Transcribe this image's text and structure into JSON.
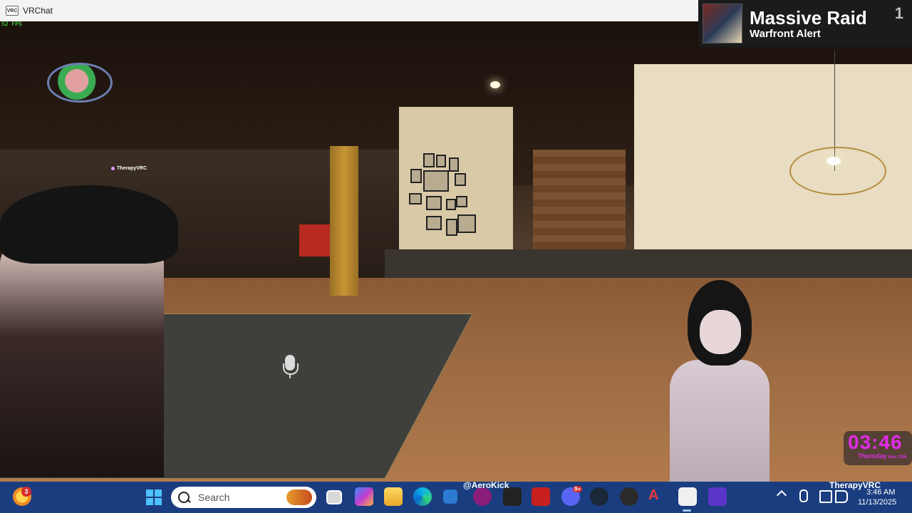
{
  "window": {
    "title": "VRChat",
    "app_icon_text": "VRC"
  },
  "viewport": {
    "fps_text": "52 FPS",
    "nametag": "TherapyVRC"
  },
  "notification": {
    "title": "Massive Raid",
    "subtitle": "Warfront Alert",
    "count": "1"
  },
  "clock_widget": {
    "time": "03:46",
    "day": "Thursday",
    "date_small": "Nov 13th",
    "color": "#e02ce6"
  },
  "taskbar": {
    "weather_badge": "3",
    "search_placeholder": "Search",
    "kick_label": "@AeroKick",
    "user_label": "TherapyVRC",
    "time": "3:46 AM",
    "date": "11/13/2025",
    "discord_badge": "9+",
    "apps": [
      "file-explorer-icon",
      "copilot-icon",
      "folder-icon",
      "edge-icon",
      "store-icon",
      "kick-icon",
      "epic-games-icon",
      "voicemeeter-icon",
      "discord-icon",
      "steam-icon",
      "obs-icon",
      "aero-icon",
      "vrchat-icon",
      "vr-icon"
    ]
  },
  "colors": {
    "taskbar": "#1a3d80",
    "accent": "#4cc2ff"
  }
}
